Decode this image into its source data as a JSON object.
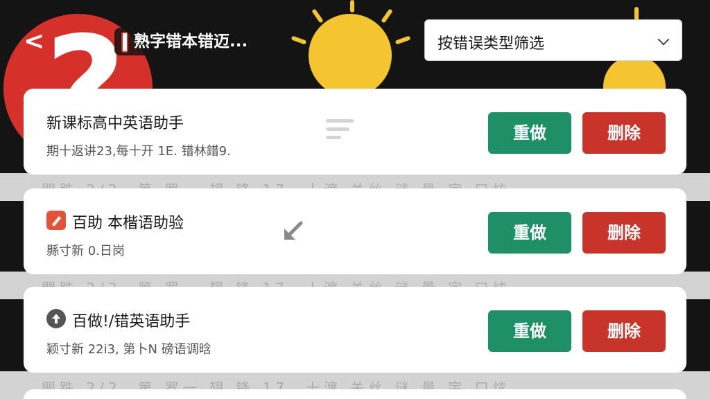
{
  "header": {
    "back_label": "<",
    "title": "熟字错本错迈..."
  },
  "filter": {
    "selected": "按错误类型筛选"
  },
  "cards": [
    {
      "title": "新课标高中英语助手",
      "subtitle": "期十返讲23,每十开 1E. 错林錯9.",
      "redo_label": "重做",
      "delete_label": "删除"
    },
    {
      "title": "百助 本楷语助验",
      "subtitle": "縣寸新 0.日岗",
      "redo_label": "重做",
      "delete_label": "删除"
    },
    {
      "title": "百做!/错英语助手",
      "subtitle": "颖寸新 22i3, 第卜N 磅语调晗",
      "redo_label": "重做",
      "delete_label": "删除"
    }
  ],
  "background_strip_text": "開跌 2/2, 第 罗一 翅 锋 17, 十渡 关丝 谜 量 宇 口炫",
  "colors": {
    "accent_green": "#1f8f68",
    "accent_red": "#c8342a",
    "bulb_yellow": "#f4c531"
  },
  "icons": {
    "back": "chevron-left-icon",
    "dropdown": "chevron-down-icon",
    "card2": "edit-icon",
    "card3": "upload-icon",
    "menu": "menu-icon",
    "arrow": "arrow-down-left-icon"
  }
}
